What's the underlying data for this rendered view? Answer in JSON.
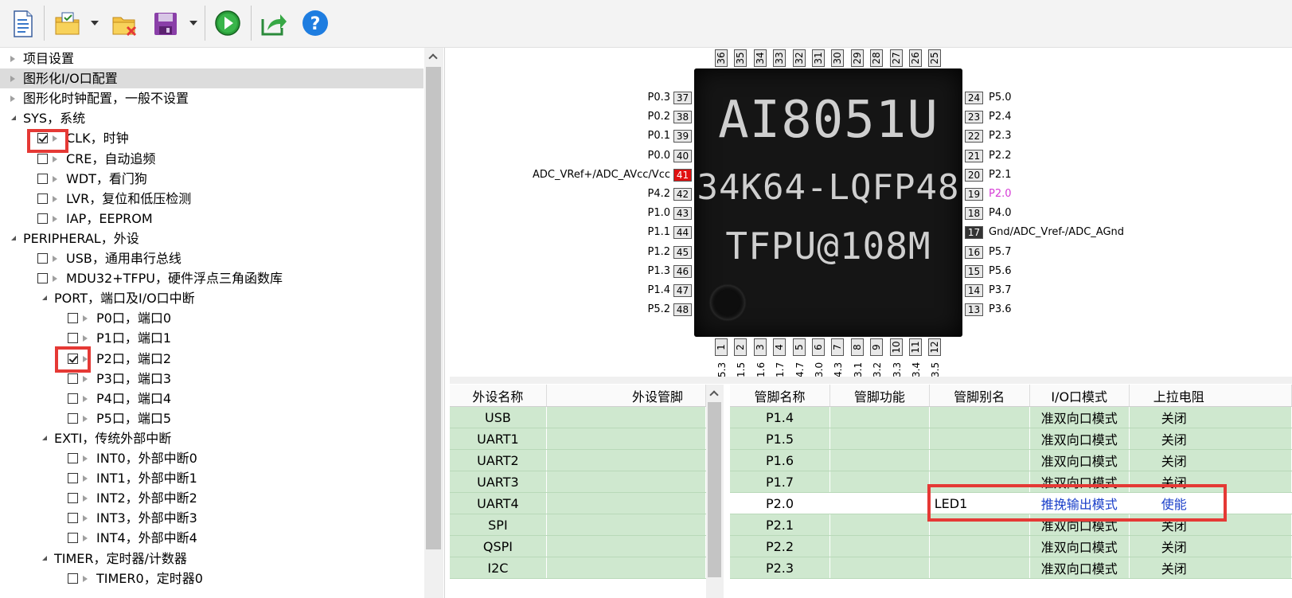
{
  "toolbar": {
    "icons": [
      "new-file-icon",
      "open-project-icon",
      "close-project-icon",
      "save-icon",
      "run-icon",
      "export-icon",
      "help-icon"
    ]
  },
  "tree": {
    "items": [
      {
        "label": "项目设置",
        "level": 0,
        "type": "leaf",
        "checkbox": false
      },
      {
        "label": "图形化I/O口配置",
        "level": 0,
        "type": "leaf",
        "checkbox": false,
        "selected": true
      },
      {
        "label": "图形化时钟配置，一般不设置",
        "level": 0,
        "type": "leaf",
        "checkbox": false
      },
      {
        "label": "SYS，系统",
        "level": 0,
        "type": "open",
        "checkbox": false
      },
      {
        "label": "CLK，时钟",
        "level": 1,
        "type": "leaf",
        "checkbox": true,
        "checked": true
      },
      {
        "label": "CRE，自动追频",
        "level": 1,
        "type": "leaf",
        "checkbox": true,
        "checked": false
      },
      {
        "label": "WDT，看门狗",
        "level": 1,
        "type": "leaf",
        "checkbox": true,
        "checked": false
      },
      {
        "label": "LVR，复位和低压检测",
        "level": 1,
        "type": "leaf",
        "checkbox": true,
        "checked": false
      },
      {
        "label": "IAP，EEPROM",
        "level": 1,
        "type": "leaf",
        "checkbox": true,
        "checked": false
      },
      {
        "label": "PERIPHERAL，外设",
        "level": 0,
        "type": "open",
        "checkbox": false
      },
      {
        "label": "USB，通用串行总线",
        "level": 1,
        "type": "leaf",
        "checkbox": true,
        "checked": false
      },
      {
        "label": "MDU32+TFPU，硬件浮点三角函数库",
        "level": 1,
        "type": "leaf",
        "checkbox": true,
        "checked": false
      },
      {
        "label": "PORT，端口及I/O口中断",
        "level": 1,
        "type": "open",
        "checkbox": false
      },
      {
        "label": "P0口，端口0",
        "level": 2,
        "type": "leaf",
        "checkbox": true,
        "checked": false
      },
      {
        "label": "P1口，端口1",
        "level": 2,
        "type": "leaf",
        "checkbox": true,
        "checked": false
      },
      {
        "label": "P2口，端口2",
        "level": 2,
        "type": "leaf",
        "checkbox": true,
        "checked": true
      },
      {
        "label": "P3口，端口3",
        "level": 2,
        "type": "leaf",
        "checkbox": true,
        "checked": false
      },
      {
        "label": "P4口，端口4",
        "level": 2,
        "type": "leaf",
        "checkbox": true,
        "checked": false
      },
      {
        "label": "P5口，端口5",
        "level": 2,
        "type": "leaf",
        "checkbox": true,
        "checked": false
      },
      {
        "label": "EXTI，传统外部中断",
        "level": 1,
        "type": "open",
        "checkbox": false
      },
      {
        "label": "INT0，外部中断0",
        "level": 2,
        "type": "leaf",
        "checkbox": true,
        "checked": false
      },
      {
        "label": "INT1，外部中断1",
        "level": 2,
        "type": "leaf",
        "checkbox": true,
        "checked": false
      },
      {
        "label": "INT2，外部中断2",
        "level": 2,
        "type": "leaf",
        "checkbox": true,
        "checked": false
      },
      {
        "label": "INT3，外部中断3",
        "level": 2,
        "type": "leaf",
        "checkbox": true,
        "checked": false
      },
      {
        "label": "INT4，外部中断4",
        "level": 2,
        "type": "leaf",
        "checkbox": true,
        "checked": false
      },
      {
        "label": "TIMER，定时器/计数器",
        "level": 1,
        "type": "open",
        "checkbox": false
      },
      {
        "label": "TIMER0，定时器0",
        "level": 2,
        "type": "leaf",
        "checkbox": true,
        "checked": false
      }
    ]
  },
  "chip": {
    "line1": "AI8051U",
    "line2": "34K64-LQFP48",
    "line3": "TFPU@108M",
    "top_pins": [
      "36",
      "35",
      "34",
      "33",
      "32",
      "31",
      "30",
      "29",
      "28",
      "27",
      "26",
      "25"
    ],
    "bottom_pins": [
      "1",
      "2",
      "3",
      "4",
      "5",
      "6",
      "7",
      "8",
      "9",
      "10",
      "11",
      "12"
    ],
    "bottom_pin_labels": [
      "5.3",
      "1.5",
      "1.6",
      "1.7",
      "4.7",
      "3.0",
      "4.3",
      "3.1",
      "3.2",
      "3.3",
      "3.4",
      "3.5"
    ],
    "left_pins": [
      {
        "num": "37",
        "name": "P0.3"
      },
      {
        "num": "38",
        "name": "P0.2"
      },
      {
        "num": "39",
        "name": "P0.1"
      },
      {
        "num": "40",
        "name": "P0.0"
      },
      {
        "num": "41",
        "name": "ADC_VRef+/ADC_AVcc/Vcc",
        "style": "red"
      },
      {
        "num": "42",
        "name": "P4.2"
      },
      {
        "num": "43",
        "name": "P1.0"
      },
      {
        "num": "44",
        "name": "P1.1"
      },
      {
        "num": "45",
        "name": "P1.2"
      },
      {
        "num": "46",
        "name": "P1.3"
      },
      {
        "num": "47",
        "name": "P1.4"
      },
      {
        "num": "48",
        "name": "P5.2"
      }
    ],
    "right_pins": [
      {
        "num": "24",
        "name": "P5.0"
      },
      {
        "num": "23",
        "name": "P2.4"
      },
      {
        "num": "22",
        "name": "P2.3"
      },
      {
        "num": "21",
        "name": "P2.2"
      },
      {
        "num": "20",
        "name": "P2.1"
      },
      {
        "num": "19",
        "name": "P2.0",
        "style": "magenta"
      },
      {
        "num": "18",
        "name": "P4.0"
      },
      {
        "num": "17",
        "name": "Gnd/ADC_Vref-/ADC_AGnd",
        "style": "dark"
      },
      {
        "num": "16",
        "name": "P5.7"
      },
      {
        "num": "15",
        "name": "P5.6"
      },
      {
        "num": "14",
        "name": "P3.7"
      },
      {
        "num": "13",
        "name": "P3.6"
      }
    ],
    "colors": {
      "red": "#e01010",
      "dark": "#333333",
      "magenta": "#d63bd6"
    }
  },
  "peripheral_table": {
    "headers": [
      "外设名称",
      "外设管脚"
    ],
    "rows": [
      [
        "USB",
        ""
      ],
      [
        "UART1",
        ""
      ],
      [
        "UART2",
        ""
      ],
      [
        "UART3",
        ""
      ],
      [
        "UART4",
        ""
      ],
      [
        "SPI",
        ""
      ],
      [
        "QSPI",
        ""
      ],
      [
        "I2C",
        ""
      ]
    ]
  },
  "pin_table": {
    "headers": [
      "管脚名称",
      "管脚功能",
      "管脚别名",
      "I/O口模式",
      "上拉电阻"
    ],
    "rows": [
      [
        "P1.4",
        "",
        "",
        "准双向口模式",
        "关闭"
      ],
      [
        "P1.5",
        "",
        "",
        "准双向口模式",
        "关闭"
      ],
      [
        "P1.6",
        "",
        "",
        "准双向口模式",
        "关闭"
      ],
      [
        "P1.7",
        "",
        "",
        "准双向口模式",
        "关闭"
      ],
      [
        "P2.0",
        "",
        "LED1",
        "推挽输出模式",
        "使能"
      ],
      [
        "P2.1",
        "",
        "",
        "准双向口模式",
        "关闭"
      ],
      [
        "P2.2",
        "",
        "",
        "准双向口模式",
        "关闭"
      ],
      [
        "P2.3",
        "",
        "",
        "准双向口模式",
        "关闭"
      ]
    ],
    "highlight_row": 4
  }
}
